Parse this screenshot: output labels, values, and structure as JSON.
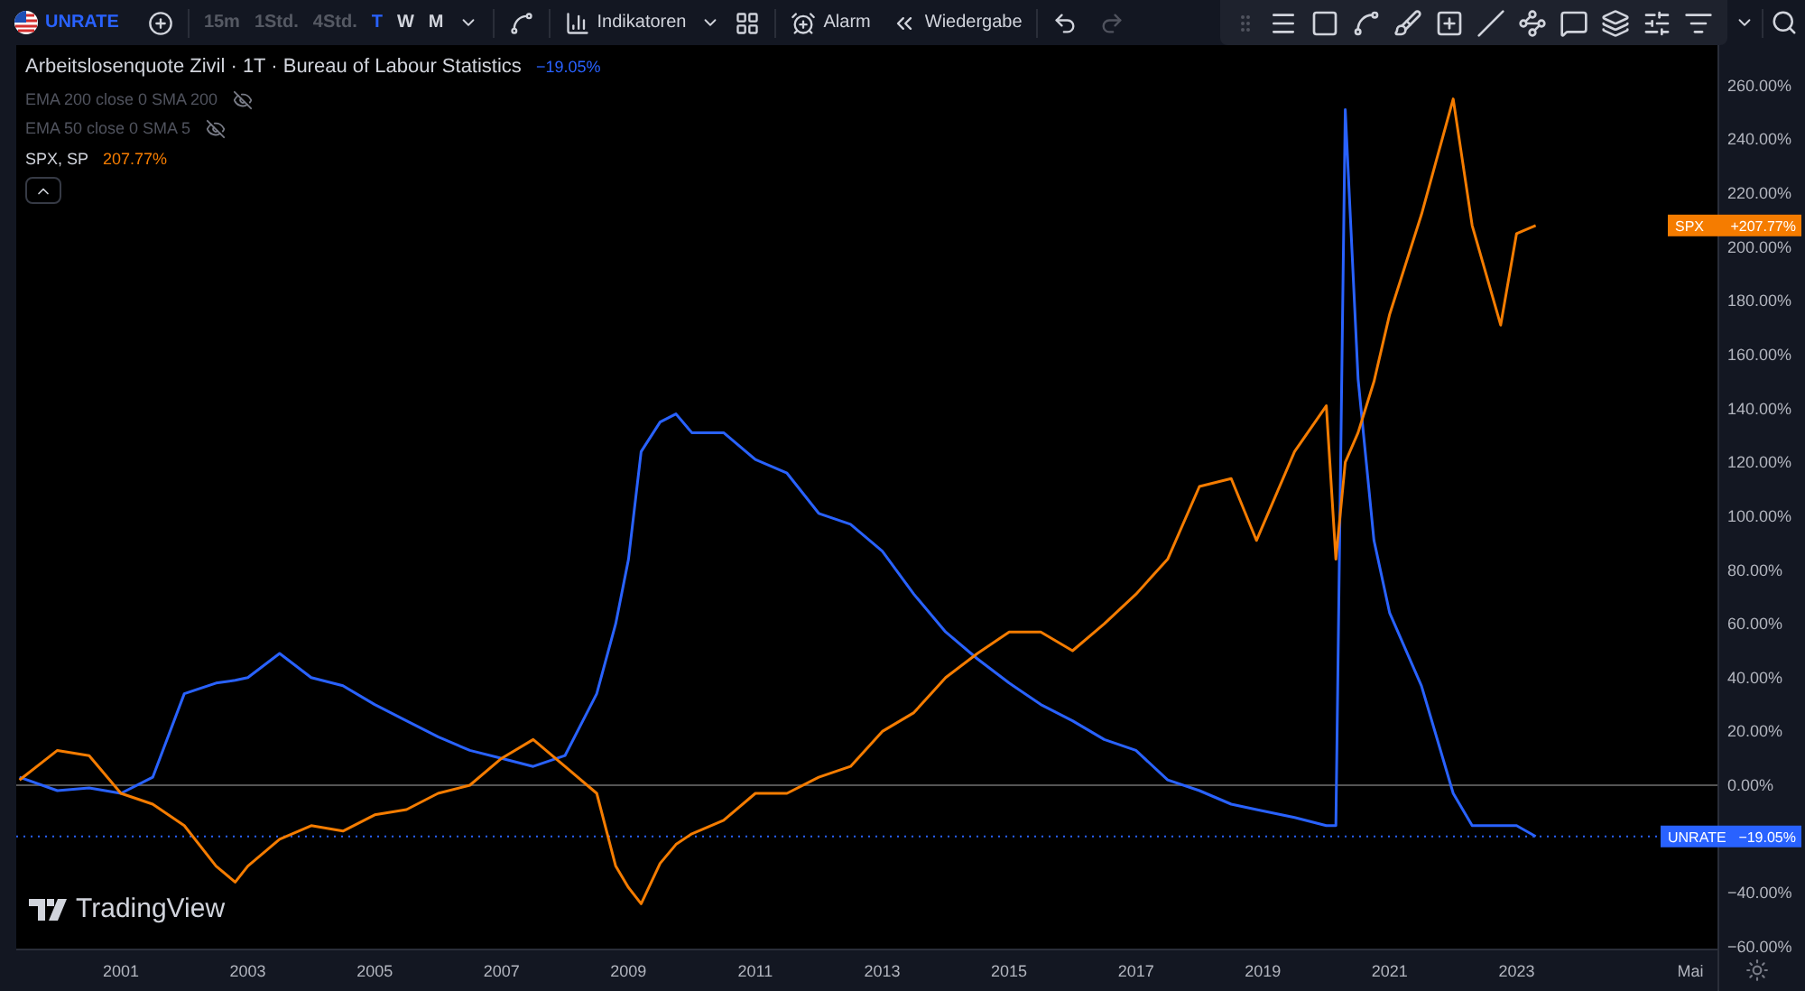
{
  "toolbar": {
    "symbol": "UNRATE",
    "intervals": [
      {
        "label": "15m",
        "selected": false,
        "disabled": true
      },
      {
        "label": "1Std.",
        "selected": false,
        "disabled": true
      },
      {
        "label": "4Std.",
        "selected": false,
        "disabled": true
      },
      {
        "label": "T",
        "selected": true,
        "disabled": false
      },
      {
        "label": "W",
        "selected": false,
        "disabled": false
      },
      {
        "label": "M",
        "selected": false,
        "disabled": false
      }
    ],
    "indicators_label": "Indikatoren",
    "alarm_label": "Alarm",
    "replay_label": "Wiedergabe",
    "redo_disabled": true
  },
  "legend": {
    "title": "Arbeitslosenquote Zivil · 1T · Bureau of Labour Statistics",
    "value": "−19.05%",
    "indicators": [
      {
        "label": "EMA 200 close 0 SMA 200",
        "hidden": true
      },
      {
        "label": "EMA 50 close 0 SMA 5",
        "hidden": true
      }
    ],
    "compare": {
      "label": "SPX, SP",
      "value": "207.77%"
    }
  },
  "chart": {
    "watermark": "TradingView",
    "price_labels": [
      {
        "value": "+207.77%"
      },
      {
        "value": "−19.05%"
      }
    ],
    "chart_data": {
      "type": "line",
      "xlim": [
        1999.35,
        2026.18
      ],
      "ylim": [
        -61,
        275
      ],
      "xticks": [
        {
          "value": 2001,
          "label": "2001"
        },
        {
          "value": 2003,
          "label": "2003"
        },
        {
          "value": 2005,
          "label": "2005"
        },
        {
          "value": 2007,
          "label": "2007"
        },
        {
          "value": 2009,
          "label": "2009"
        },
        {
          "value": 2011,
          "label": "2011"
        },
        {
          "value": 2013,
          "label": "2013"
        },
        {
          "value": 2015,
          "label": "2015"
        },
        {
          "value": 2017,
          "label": "2017"
        },
        {
          "value": 2019,
          "label": "2019"
        },
        {
          "value": 2021,
          "label": "2021"
        },
        {
          "value": 2023,
          "label": "2023"
        },
        {
          "value": 2025.74,
          "label": "Mai"
        }
      ],
      "yticks": [
        {
          "value": 260,
          "label": "260.00%"
        },
        {
          "value": 240,
          "label": "240.00%"
        },
        {
          "value": 220,
          "label": "220.00%"
        },
        {
          "value": 200,
          "label": "200.00%"
        },
        {
          "value": 180,
          "label": "180.00%"
        },
        {
          "value": 160,
          "label": "160.00%"
        },
        {
          "value": 140,
          "label": "140.00%"
        },
        {
          "value": 120,
          "label": "120.00%"
        },
        {
          "value": 100,
          "label": "100.00%"
        },
        {
          "value": 80,
          "label": "80.00%"
        },
        {
          "value": 60,
          "label": "60.00%"
        },
        {
          "value": 40,
          "label": "40.00%"
        },
        {
          "value": 20,
          "label": "20.00%"
        },
        {
          "value": 0,
          "label": "0.00%"
        },
        {
          "value": -40,
          "label": "−40.00%"
        },
        {
          "value": -60,
          "label": "−60.00%"
        }
      ],
      "x": [
        1999.4,
        2000,
        2000.5,
        2001,
        2001.5,
        2002,
        2002.5,
        2002.8,
        2003,
        2003.5,
        2004,
        2004.5,
        2005,
        2005.5,
        2006,
        2006.5,
        2007,
        2007.5,
        2008,
        2008.5,
        2008.8,
        2009,
        2009.2,
        2009.5,
        2009.75,
        2010,
        2010.5,
        2011,
        2011.5,
        2012,
        2012.5,
        2013,
        2013.5,
        2014,
        2014.5,
        2015,
        2015.5,
        2016,
        2016.5,
        2017,
        2017.5,
        2018,
        2018.5,
        2018.9,
        2019.5,
        2020,
        2020.15,
        2020.3,
        2020.5,
        2020.75,
        2021,
        2021.5,
        2022,
        2022.3,
        2022.75,
        2023,
        2023.3
      ],
      "series": [
        {
          "name": "UNRATE",
          "color": "#2962ff",
          "values": [
            3,
            -2,
            -1,
            -3,
            3,
            34,
            38,
            39,
            40,
            49,
            40,
            37,
            30,
            24,
            18,
            13,
            10,
            7,
            11,
            34,
            60,
            84,
            124,
            135,
            138,
            131,
            131,
            121,
            116,
            101,
            97,
            87,
            71,
            57,
            47,
            38,
            30,
            24,
            17,
            13,
            2,
            -2,
            -7,
            -9,
            -12,
            -15,
            -15,
            251,
            151,
            91,
            64,
            37,
            -3,
            -15,
            -15,
            -15,
            -19
          ]
        },
        {
          "name": "SPX",
          "color": "#f57c00",
          "values": [
            2,
            13,
            11,
            -3,
            -7,
            -15,
            -30,
            -36,
            -30,
            -20,
            -15,
            -17,
            -11,
            -9,
            -3,
            0,
            10,
            17,
            7,
            -3,
            -30,
            -38,
            -44,
            -29,
            -22,
            -18,
            -13,
            -3,
            -3,
            3,
            7,
            20,
            27,
            40,
            49,
            57,
            57,
            50,
            60,
            71,
            84,
            111,
            114,
            91,
            124,
            141,
            84,
            120,
            131,
            150,
            175,
            212,
            255,
            208,
            171,
            205,
            208
          ]
        }
      ]
    }
  }
}
